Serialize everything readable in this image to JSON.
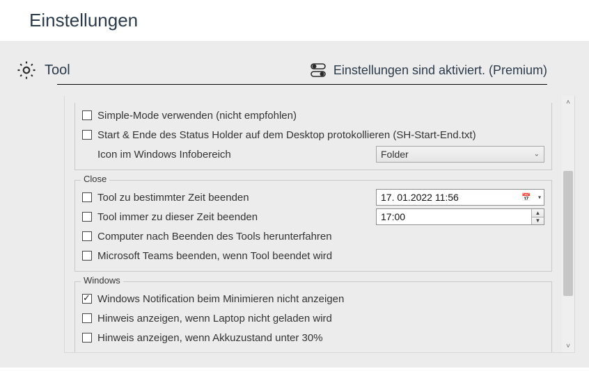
{
  "page_title": "Einstellungen",
  "section": {
    "name": "Tool",
    "status": "Einstellungen sind aktiviert. (Premium)"
  },
  "top_group": {
    "simple_mode": {
      "label": "Simple-Mode verwenden (nicht empfohlen)",
      "checked": false
    },
    "log_start_end": {
      "label": "Start & Ende des Status Holder auf dem Desktop protokollieren (SH-Start-End.txt)",
      "checked": false
    },
    "tray_icon_label": "Icon im Windows Infobereich",
    "tray_icon_value": "Folder"
  },
  "close_group": {
    "legend": "Close",
    "end_at_time": {
      "label": "Tool zu bestimmter Zeit beenden",
      "checked": false,
      "value": "17. 01.2022    11:56"
    },
    "always_end_at": {
      "label": "Tool immer zu dieser Zeit beenden",
      "checked": false,
      "value": "17:00"
    },
    "shutdown_after": {
      "label": "Computer nach Beenden des Tools herunterfahren",
      "checked": false
    },
    "quit_teams": {
      "label": "Microsoft Teams beenden, wenn Tool beendet wird",
      "checked": false
    }
  },
  "windows_group": {
    "legend": "Windows",
    "no_min_notif": {
      "label": "Windows Notification beim Minimieren nicht anzeigen",
      "checked": true
    },
    "laptop_not_charging": {
      "label": "Hinweis anzeigen, wenn Laptop nicht geladen wird",
      "checked": false
    },
    "battery_below_30": {
      "label": "Hinweis anzeigen, wenn Akkuzustand unter 30%",
      "checked": false
    }
  }
}
